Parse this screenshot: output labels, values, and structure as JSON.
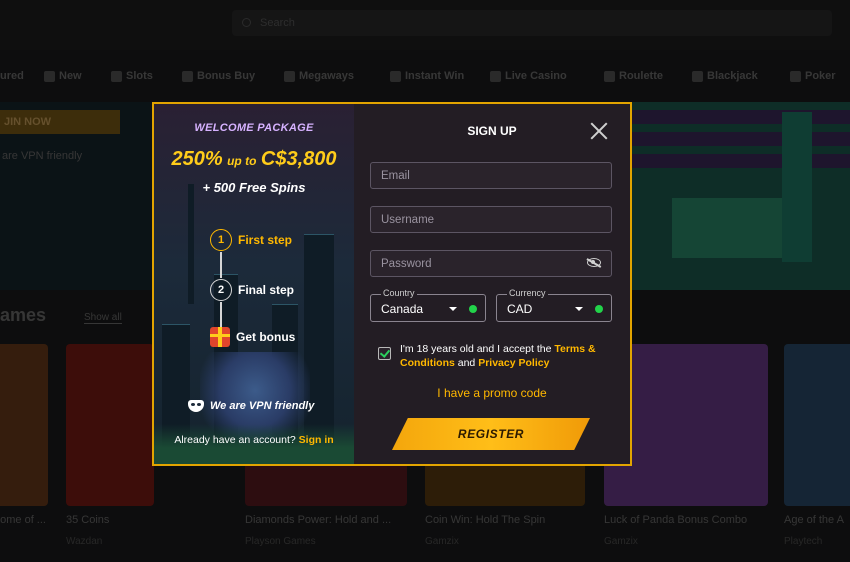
{
  "background": {
    "search_placeholder": "Search",
    "nav": [
      {
        "label": "ured",
        "icon": "star-icon"
      },
      {
        "label": "New",
        "icon": "new-icon"
      },
      {
        "label": "Slots",
        "icon": "slots-icon"
      },
      {
        "label": "Bonus Buy",
        "icon": "bonus-buy-icon"
      },
      {
        "label": "Megaways",
        "icon": "megaways-icon"
      },
      {
        "label": "Instant Win",
        "icon": "instant-win-icon"
      },
      {
        "label": "Live Casino",
        "icon": "live-casino-icon"
      },
      {
        "label": "Roulette",
        "icon": "roulette-icon"
      },
      {
        "label": "Blackjack",
        "icon": "blackjack-icon"
      },
      {
        "label": "Poker",
        "icon": "poker-icon"
      }
    ],
    "hero_button": "JIN NOW",
    "hero_vpn": "are VPN friendly",
    "games_title": "ames",
    "show_all": "Show all",
    "cards": [
      {
        "name": "nome of ...",
        "provider": ""
      },
      {
        "name": "35 Coins",
        "provider": "Wazdan"
      },
      {
        "name": "Diamonds Power: Hold and ...",
        "provider": "Playson Games"
      },
      {
        "name": "Coin Win: Hold The Spin",
        "provider": "Gamzix"
      },
      {
        "name": "Luck of Panda Bonus Combo",
        "provider": "Gamzix"
      },
      {
        "name": "Age of the A",
        "provider": "Playtech"
      }
    ]
  },
  "promo": {
    "welcome": "WELCOME PACKAGE",
    "bonus_percent": "250%",
    "bonus_upto": "up to",
    "bonus_amount": "C$3,800",
    "spins": "+ 500 Free Spins",
    "steps": [
      {
        "num": "1",
        "label": "First step",
        "color": "#ffb800"
      },
      {
        "num": "2",
        "label": "Final step",
        "color": "#ffffff"
      },
      {
        "num": "",
        "label": "Get bonus",
        "color": "#ffffff"
      }
    ],
    "vpn": "We are VPN friendly",
    "already_text": "Already have an account?",
    "signin": "Sign in"
  },
  "form": {
    "title": "SIGN UP",
    "email_placeholder": "Email",
    "username_placeholder": "Username",
    "password_placeholder": "Password",
    "country_label": "Country",
    "country_value": "Canada",
    "currency_label": "Currency",
    "currency_value": "CAD",
    "terms_prefix": "I'm 18 years old and I accept the",
    "terms_link": "Terms & Conditions",
    "terms_and": "and",
    "privacy_link": "Privacy Policy",
    "promo_code": "I have a promo code",
    "register": "REGISTER"
  },
  "colors": {
    "accent": "#ffb800",
    "border": "#e2a400",
    "ok": "#22d34a"
  }
}
